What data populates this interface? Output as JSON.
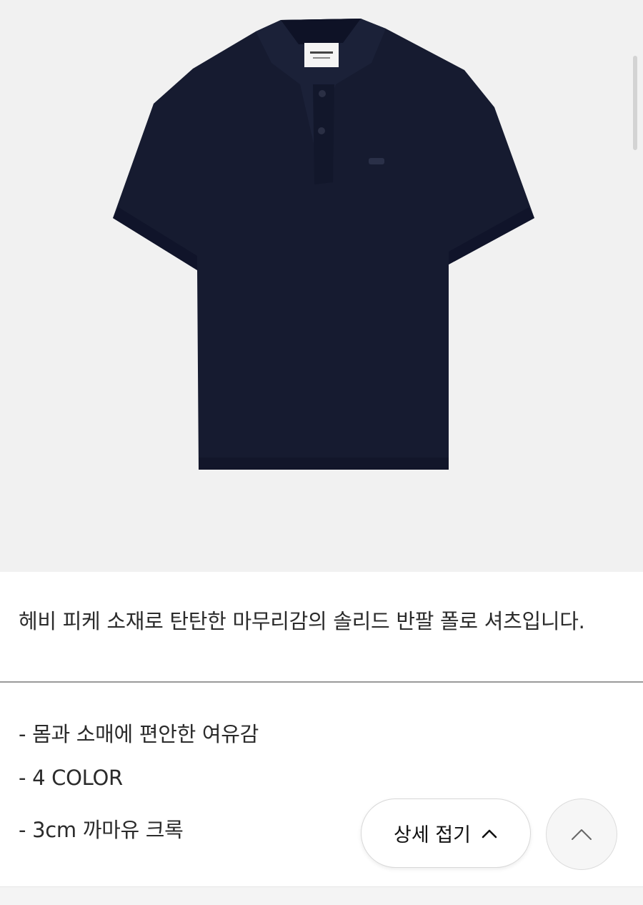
{
  "product": {
    "image_alt": "navy short sleeve polo shirt",
    "color": "#151a2e",
    "description": "헤비 피케 소재로 탄탄한 마무리감의 솔리드 반팔 폴로 셔츠입니다."
  },
  "features": [
    "- 몸과 소매에 편안한 여유감",
    "- 4 COLOR",
    "- 3cm 까마유 크록"
  ],
  "controls": {
    "collapse_label": "상세 접기",
    "collapse_icon": "chevron-up-icon",
    "scroll_top_icon": "chevron-up-icon"
  }
}
